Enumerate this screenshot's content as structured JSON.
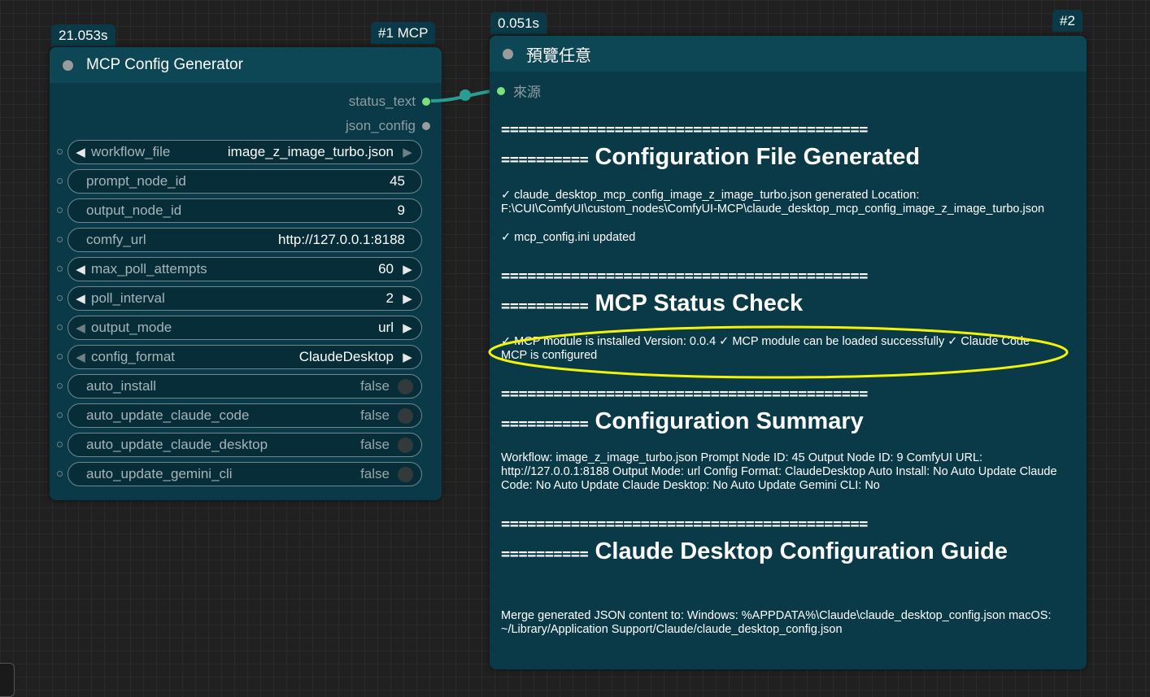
{
  "node1": {
    "time_badge": "21.053s",
    "id_badge": "#1 MCP",
    "title": "MCP Config Generator",
    "outputs": [
      {
        "label": "status_text",
        "color": "#7be07b"
      },
      {
        "label": "json_config",
        "color": "#9c9c9c"
      }
    ],
    "widgets": [
      {
        "name": "workflow_file",
        "value": "image_z_image_turbo.json",
        "type": "combo"
      },
      {
        "name": "prompt_node_id",
        "value": "45",
        "type": "text"
      },
      {
        "name": "output_node_id",
        "value": "9",
        "type": "text"
      },
      {
        "name": "comfy_url",
        "value": "http://127.0.0.1:8188",
        "type": "text"
      },
      {
        "name": "max_poll_attempts",
        "value": "60",
        "type": "number"
      },
      {
        "name": "poll_interval",
        "value": "2",
        "type": "number"
      },
      {
        "name": "output_mode",
        "value": "url",
        "type": "combo"
      },
      {
        "name": "config_format",
        "value": "ClaudeDesktop",
        "type": "combo"
      },
      {
        "name": "auto_install",
        "value": "false",
        "type": "toggle"
      },
      {
        "name": "auto_update_claude_code",
        "value": "false",
        "type": "toggle"
      },
      {
        "name": "auto_update_claude_desktop",
        "value": "false",
        "type": "toggle"
      },
      {
        "name": "auto_update_gemini_cli",
        "value": "false",
        "type": "toggle"
      }
    ]
  },
  "node2": {
    "time_badge": "0.051s",
    "id_badge": "#2",
    "title": "預覽任意",
    "input_label": "來源",
    "separator": "==========================================",
    "sections": [
      {
        "heading_eq": "==========",
        "heading": "Configuration File Generated",
        "paragraphs": [
          "✓ claude_desktop_mcp_config_image_z_image_turbo.json generated Location: F:\\CUI\\ComfyUI\\custom_nodes\\ComfyUI-MCP\\claude_desktop_mcp_config_image_z_image_turbo.json",
          "✓ mcp_config.ini updated"
        ]
      },
      {
        "heading_eq": "==========",
        "heading": "MCP Status Check",
        "paragraphs": [
          "✓ MCP module is installed Version: 0.0.4 ✓ MCP module can be loaded successfully ✓ Claude Code MCP is configured"
        ]
      },
      {
        "heading_eq": "==========",
        "heading": "Configuration Summary",
        "paragraphs": [
          "Workflow: image_z_image_turbo.json Prompt Node ID: 45 Output Node ID: 9 ComfyUI URL: http://127.0.0.1:8188 Output Mode: url Config Format: ClaudeDesktop Auto Install: No Auto Update Claude Code: No Auto Update Claude Desktop: No Auto Update Gemini CLI: No"
        ]
      },
      {
        "heading_eq": "==========",
        "heading": "Claude Desktop Configuration Guide",
        "paragraphs": [
          "Merge generated JSON content to: Windows: %APPDATA%\\Claude\\claude_desktop_config.json macOS: ~/Library/Application Support/Claude/claude_desktop_config.json"
        ]
      }
    ]
  },
  "colors": {
    "node_bg": "#0a3a48",
    "link": "#2a9d93",
    "highlight": "#f2f20a",
    "connected_slot": "#7be07b"
  }
}
